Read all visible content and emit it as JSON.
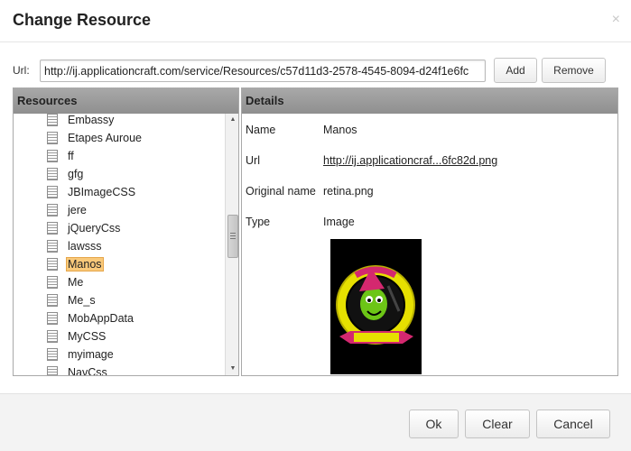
{
  "dialog": {
    "title": "Change Resource",
    "close": "×"
  },
  "url_bar": {
    "label": "Url:",
    "value": "http://ij.applicationcraft.com/service/Resources/c57d11d3-2578-4545-8094-d24f1e6fc",
    "add_label": "Add",
    "remove_label": "Remove"
  },
  "resources": {
    "header": "Resources",
    "items": [
      {
        "label": "Embassy"
      },
      {
        "label": "Etapes Auroue"
      },
      {
        "label": "ff"
      },
      {
        "label": "gfg"
      },
      {
        "label": "JBImageCSS"
      },
      {
        "label": "jere"
      },
      {
        "label": "jQueryCss"
      },
      {
        "label": "lawsss"
      },
      {
        "label": "Manos",
        "selected": true
      },
      {
        "label": "Me"
      },
      {
        "label": "Me_s"
      },
      {
        "label": "MobAppData"
      },
      {
        "label": "MyCSS"
      },
      {
        "label": "myimage"
      },
      {
        "label": "NavCss"
      }
    ],
    "scroll_up": "▲",
    "scroll_down": "▼"
  },
  "details": {
    "header": "Details",
    "name_label": "Name",
    "name_value": "Manos",
    "url_label": "Url",
    "url_value": "http://ij.applicationcraf...6fc82d.png",
    "original_label": "Original name",
    "original_value": "retina.png",
    "type_label": "Type",
    "type_value": "Image"
  },
  "footer": {
    "ok_label": "Ok",
    "clear_label": "Clear",
    "cancel_label": "Cancel"
  },
  "colors": {
    "selection": "#f9c97a",
    "header_bg": "#9d9d9d",
    "footer_bg": "#f3f3f3"
  }
}
